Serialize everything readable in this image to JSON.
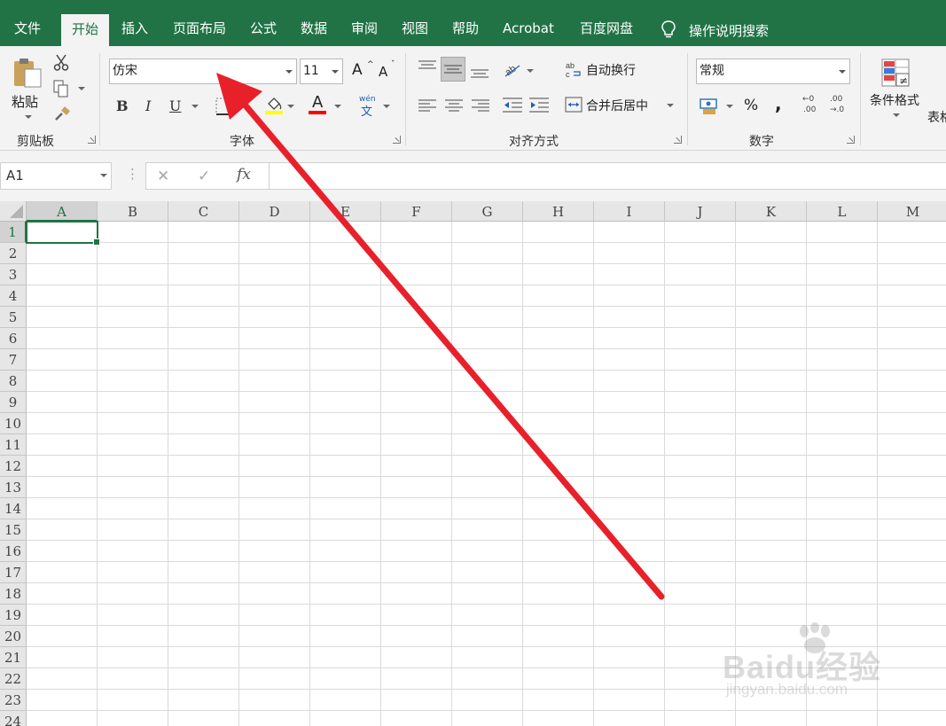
{
  "menu": {
    "tabs": [
      "文件",
      "开始",
      "插入",
      "页面布局",
      "公式",
      "数据",
      "审阅",
      "视图",
      "帮助",
      "Acrobat",
      "百度网盘"
    ],
    "active_tab": "开始",
    "tell_me": "操作说明搜索"
  },
  "ribbon": {
    "clipboard": {
      "paste": "粘贴",
      "label": "剪贴板"
    },
    "font": {
      "name": "仿宋",
      "size": "11",
      "bold": "B",
      "italic": "I",
      "underline": "U",
      "label": "字体",
      "grow": "A",
      "shrink": "A",
      "font_color_glyph": "A",
      "phonetic": "wén",
      "phonetic_char": "文"
    },
    "alignment": {
      "wrap_text": "自动换行",
      "merge_center": "合并后居中",
      "label": "对齐方式"
    },
    "number": {
      "format": "常规",
      "percent": "%",
      "comma": ",",
      "label": "数字",
      "inc_decimal": ".00",
      "dec_decimal": ".00"
    },
    "styles": {
      "conditional_formatting": "条件格式",
      "table_partial": "表格"
    }
  },
  "formula_bar": {
    "name_box": "A1",
    "fx": "fx",
    "cancel": "✕",
    "enter": "✓"
  },
  "grid": {
    "columns": [
      "A",
      "B",
      "C",
      "D",
      "E",
      "F",
      "G",
      "H",
      "I",
      "J",
      "K",
      "L",
      "M"
    ],
    "rows": [
      "1",
      "2",
      "3",
      "4",
      "5",
      "6",
      "7",
      "8",
      "9",
      "10",
      "11",
      "12",
      "13",
      "14",
      "15",
      "16",
      "17",
      "18",
      "19",
      "20",
      "21",
      "22",
      "23",
      "24"
    ],
    "active_cell": "A1"
  },
  "watermark": {
    "logo": "Baidu经验",
    "url": "jingyan.baidu.com"
  },
  "colors": {
    "excel_green": "#217346",
    "ribbon_bg": "#f3f3f3",
    "arrow_red": "#e8202a",
    "highlight_yellow": "#ffff00",
    "font_color_red": "#ff0000"
  },
  "icons": [
    "cut-icon",
    "copy-icon",
    "format-painter-icon",
    "fill-color-icon",
    "font-color-icon",
    "border-icon",
    "wrap-text-icon",
    "merge-center-icon",
    "currency-icon",
    "conditional-formatting-icon",
    "lightbulb-icon",
    "select-all-icon"
  ]
}
